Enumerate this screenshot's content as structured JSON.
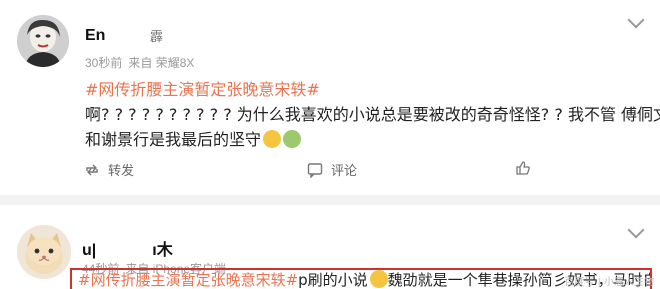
{
  "post1": {
    "username": "En",
    "badge": "霹",
    "time": "30秒前",
    "source": "来自 荣耀8X",
    "topic": "#网传折腰主演暂定张晚意宋轶#",
    "line1": "啊? ? ? ? ? ? ? ? ? ? 为什么我喜欢的小说总是要被改的奇奇怪怪? ? 我不管 傅侗文",
    "line2": "和谢景行是我最后的坚守",
    "repost_label": "转发",
    "comment_label": "评论"
  },
  "post2": {
    "username": "u|",
    "username_suffix": "ı木",
    "time": "44秒前",
    "source": "来自 iPhone客户端",
    "topic": "#网传折腰主演暂定张晚意宋轶#",
    "text": "p刷的小说",
    "text2": "魏劭就是一个隼巷操孙简彡奴书，马时自",
    "watermark": "百度号 | 小意人生物"
  },
  "colors": {
    "topic": "#eb7350",
    "highlight_border": "#d13030"
  }
}
